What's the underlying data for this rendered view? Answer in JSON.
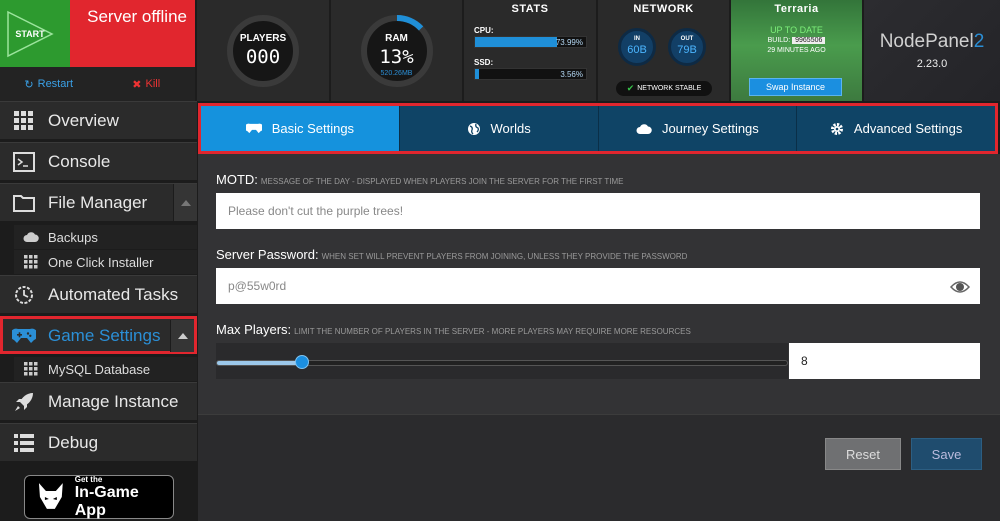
{
  "server": {
    "start_label": "START",
    "status": "Server offline",
    "restart_label": "Restart",
    "kill_label": "Kill"
  },
  "players": {
    "label": "PLAYERS",
    "value": "000"
  },
  "ram": {
    "label": "RAM",
    "value": "13%",
    "sub": "520.26MB",
    "fraction": 0.13
  },
  "stats": {
    "title": "STATS",
    "cpu_label": "CPU:",
    "cpu_value": "73.99%",
    "cpu_fraction": 0.74,
    "ssd_label": "SSD:",
    "ssd_value": "3.56%",
    "ssd_fraction": 0.036
  },
  "network": {
    "title": "NETWORK",
    "in_label": "IN",
    "in_value": "60B",
    "out_label": "OUT",
    "out_value": "79B",
    "status": "NETWORK STABLE"
  },
  "game": {
    "title": "Terraria",
    "update_status": "UP TO DATE",
    "build_label": "BUILD:",
    "build_value": "9965506",
    "updated_ago": "29 MINUTES AGO",
    "swap_label": "Swap Instance"
  },
  "brand": {
    "name": "NodePanel",
    "suffix": "2",
    "version": "2.23.0"
  },
  "sidebar": {
    "items": [
      {
        "label": "Overview",
        "icon": "grid-icon"
      },
      {
        "label": "Console",
        "icon": "terminal-icon"
      },
      {
        "label": "File Manager",
        "icon": "folder-icon"
      },
      {
        "label": "Backups",
        "icon": "cloud-icon"
      },
      {
        "label": "One Click Installer",
        "icon": "grid-icon"
      },
      {
        "label": "Automated Tasks",
        "icon": "clock-icon"
      },
      {
        "label": "Game Settings",
        "icon": "gamepad-icon"
      },
      {
        "label": "MySQL Database",
        "icon": "database-icon"
      },
      {
        "label": "Manage Instance",
        "icon": "rocket-icon"
      },
      {
        "label": "Debug",
        "icon": "list-icon"
      }
    ],
    "app_badge_small": "Get the",
    "app_badge_big": "In-Game App"
  },
  "tabs": [
    {
      "label": "Basic Settings",
      "icon": "gamepad-icon"
    },
    {
      "label": "Worlds",
      "icon": "globe-icon"
    },
    {
      "label": "Journey Settings",
      "icon": "cloud-icon"
    },
    {
      "label": "Advanced Settings",
      "icon": "gear-icon"
    }
  ],
  "form": {
    "motd_label": "MOTD:",
    "motd_help": "Message of the day - displayed when players join the server for the first time",
    "motd_placeholder": "Please don't cut the purple trees!",
    "password_label": "Server Password:",
    "password_help": "When set will prevent players from joining, unless they provide the password",
    "password_value": "p@55w0rd",
    "maxplayers_label": "Max Players:",
    "maxplayers_help": "Limit the number of players in the server - more players may require more resources",
    "maxplayers_value": "8",
    "maxplayers_fraction": 0.15
  },
  "footer": {
    "reset_label": "Reset",
    "save_label": "Save"
  },
  "colors": {
    "accent": "#1592dd",
    "danger": "#e1262e",
    "success": "#2d9a2f",
    "highlight": "#e1262e"
  }
}
